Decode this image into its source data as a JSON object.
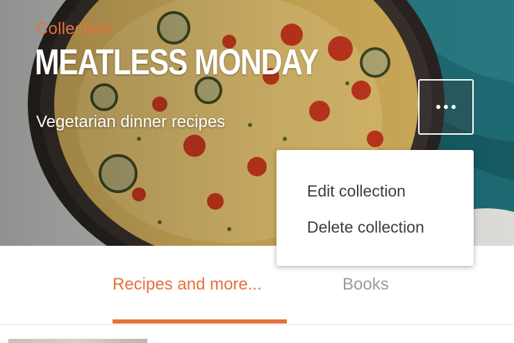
{
  "header": {
    "eyebrow": "Collection",
    "title": "MEATLESS MONDAY",
    "subtitle": "Vegetarian dinner recipes"
  },
  "more_button": {
    "icon": "more-horizontal-icon"
  },
  "menu": {
    "items": [
      {
        "label": "Edit collection"
      },
      {
        "label": "Delete collection"
      }
    ]
  },
  "tabs": [
    {
      "label": "Recipes and more...",
      "active": true
    },
    {
      "label": "Books",
      "active": false
    }
  ],
  "colors": {
    "accent": "#e8703a",
    "inactive_tab": "#9a9a9a",
    "menu_text": "#3d3d3d"
  }
}
